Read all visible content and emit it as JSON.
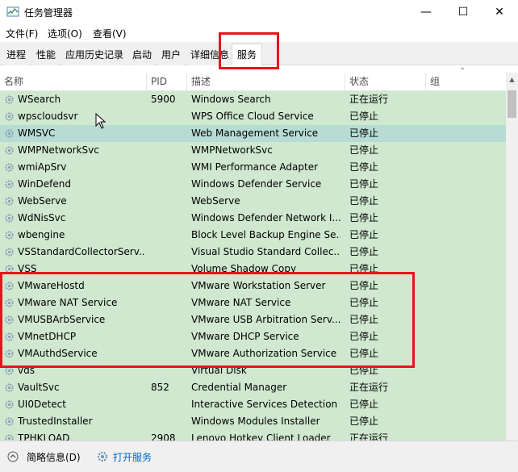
{
  "window": {
    "title": "任务管理器",
    "minimize": "—",
    "maximize": "☐",
    "close": "✕"
  },
  "menu": [
    "文件(F)",
    "选项(O)",
    "查看(V)"
  ],
  "tabs": [
    {
      "label": "进程",
      "active": false
    },
    {
      "label": "性能",
      "active": false
    },
    {
      "label": "应用历史记录",
      "active": false
    },
    {
      "label": "启动",
      "active": false
    },
    {
      "label": "用户",
      "active": false
    },
    {
      "label": "详细信息",
      "active": false
    },
    {
      "label": "服务",
      "active": true
    }
  ],
  "columns": {
    "name": "名称",
    "pid": "PID",
    "desc": "描述",
    "status": "状态",
    "group": "组"
  },
  "rows": [
    {
      "name": "WSearch",
      "pid": "5900",
      "desc": "Windows Search",
      "status": "正在运行",
      "selected": false
    },
    {
      "name": "wpscloudsvr",
      "pid": "",
      "desc": "WPS Office Cloud Service",
      "status": "已停止",
      "selected": false
    },
    {
      "name": "WMSVC",
      "pid": "",
      "desc": "Web Management Service",
      "status": "已停止",
      "selected": true
    },
    {
      "name": "WMPNetworkSvc",
      "pid": "",
      "desc": "WMPNetworkSvc",
      "status": "已停止",
      "selected": false
    },
    {
      "name": "wmiApSrv",
      "pid": "",
      "desc": "WMI Performance Adapter",
      "status": "已停止",
      "selected": false
    },
    {
      "name": "WinDefend",
      "pid": "",
      "desc": "Windows Defender Service",
      "status": "已停止",
      "selected": false
    },
    {
      "name": "WebServe",
      "pid": "",
      "desc": "WebServe",
      "status": "已停止",
      "selected": false
    },
    {
      "name": "WdNisSvc",
      "pid": "",
      "desc": "Windows Defender Network I...",
      "status": "已停止",
      "selected": false
    },
    {
      "name": "wbengine",
      "pid": "",
      "desc": "Block Level Backup Engine Se...",
      "status": "已停止",
      "selected": false
    },
    {
      "name": "VSStandardCollectorServ...",
      "pid": "",
      "desc": "Visual Studio Standard Collec...",
      "status": "已停止",
      "selected": false
    },
    {
      "name": "VSS",
      "pid": "",
      "desc": "Volume Shadow Copy",
      "status": "已停止",
      "selected": false
    },
    {
      "name": "VMwareHostd",
      "pid": "",
      "desc": "VMware Workstation Server",
      "status": "已停止",
      "selected": false
    },
    {
      "name": "VMware NAT Service",
      "pid": "",
      "desc": "VMware NAT Service",
      "status": "已停止",
      "selected": false
    },
    {
      "name": "VMUSBArbService",
      "pid": "",
      "desc": "VMware USB Arbitration Serv...",
      "status": "已停止",
      "selected": false
    },
    {
      "name": "VMnetDHCP",
      "pid": "",
      "desc": "VMware DHCP Service",
      "status": "已停止",
      "selected": false
    },
    {
      "name": "VMAuthdService",
      "pid": "",
      "desc": "VMware Authorization Service",
      "status": "已停止",
      "selected": false
    },
    {
      "name": "vds",
      "pid": "",
      "desc": "Virtual Disk",
      "status": "已停止",
      "selected": false
    },
    {
      "name": "VaultSvc",
      "pid": "852",
      "desc": "Credential Manager",
      "status": "正在运行",
      "selected": false
    },
    {
      "name": "UI0Detect",
      "pid": "",
      "desc": "Interactive Services Detection",
      "status": "已停止",
      "selected": false
    },
    {
      "name": "TrustedInstaller",
      "pid": "",
      "desc": "Windows Modules Installer",
      "status": "已停止",
      "selected": false
    },
    {
      "name": "TPHKLOAD",
      "pid": "2908",
      "desc": "Lenovo Hotkey Client Loader",
      "status": "正在运行",
      "selected": false
    }
  ],
  "footer": {
    "details": "简略信息(D)",
    "open_services": "打开服务"
  },
  "colors": {
    "row": "#cfe8cf",
    "selected": "#b6dcd3",
    "highlight": "#e8141c"
  }
}
